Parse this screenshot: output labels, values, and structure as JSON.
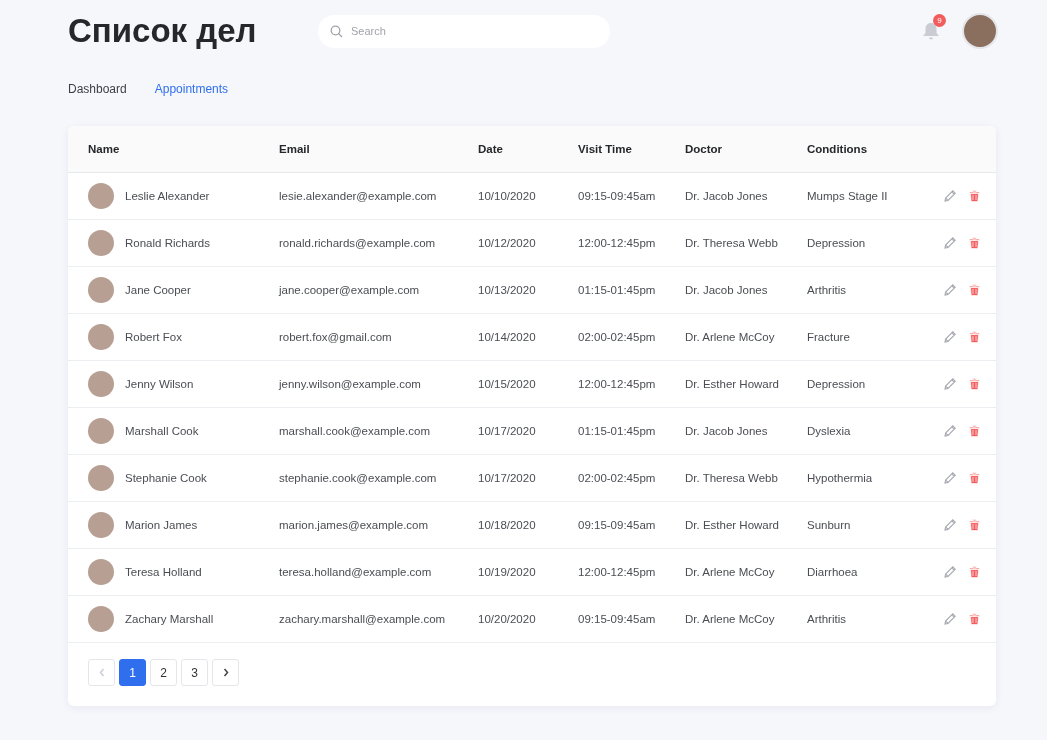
{
  "header": {
    "title": "Список дел",
    "search": {
      "placeholder": "Search"
    },
    "notifications": {
      "count": "9"
    }
  },
  "tabs": [
    {
      "label": "Dashboard",
      "selected": false
    },
    {
      "label": "Appointments",
      "selected": true
    }
  ],
  "table": {
    "columns": [
      "Name",
      "Email",
      "Date",
      "Visit Time",
      "Doctor",
      "Conditions"
    ],
    "rows": [
      {
        "name": "Leslie Alexander",
        "email": "lesie.alexander@example.com",
        "date": "10/10/2020",
        "time": "09:15-09:45am",
        "doctor": "Dr. Jacob Jones",
        "condition": "Mumps Stage II"
      },
      {
        "name": "Ronald Richards",
        "email": "ronald.richards@example.com",
        "date": "10/12/2020",
        "time": "12:00-12:45pm",
        "doctor": "Dr. Theresa Webb",
        "condition": "Depression"
      },
      {
        "name": "Jane Cooper",
        "email": "jane.cooper@example.com",
        "date": "10/13/2020",
        "time": "01:15-01:45pm",
        "doctor": "Dr. Jacob Jones",
        "condition": "Arthritis"
      },
      {
        "name": "Robert Fox",
        "email": "robert.fox@gmail.com",
        "date": "10/14/2020",
        "time": "02:00-02:45pm",
        "doctor": "Dr. Arlene McCoy",
        "condition": "Fracture"
      },
      {
        "name": "Jenny Wilson",
        "email": "jenny.wilson@example.com",
        "date": "10/15/2020",
        "time": "12:00-12:45pm",
        "doctor": "Dr. Esther Howard",
        "condition": "Depression"
      },
      {
        "name": "Marshall Cook",
        "email": "marshall.cook@example.com",
        "date": "10/17/2020",
        "time": "01:15-01:45pm",
        "doctor": "Dr. Jacob Jones",
        "condition": "Dyslexia"
      },
      {
        "name": "Stephanie Cook",
        "email": "stephanie.cook@example.com",
        "date": "10/17/2020",
        "time": "02:00-02:45pm",
        "doctor": "Dr. Theresa Webb",
        "condition": "Hypothermia"
      },
      {
        "name": "Marion James",
        "email": "marion.james@example.com",
        "date": "10/18/2020",
        "time": "09:15-09:45am",
        "doctor": "Dr. Esther Howard",
        "condition": "Sunburn"
      },
      {
        "name": "Teresa Holland",
        "email": "teresa.holland@example.com",
        "date": "10/19/2020",
        "time": "12:00-12:45pm",
        "doctor": "Dr. Arlene McCoy",
        "condition": "Diarrhoea"
      },
      {
        "name": "Zachary Marshall",
        "email": "zachary.marshall@example.com",
        "date": "10/20/2020",
        "time": "09:15-09:45am",
        "doctor": "Dr. Arlene McCoy",
        "condition": "Arthritis"
      }
    ]
  },
  "pagination": {
    "previous": {
      "disabled": true
    },
    "pages": [
      {
        "label": "1",
        "selected": true
      },
      {
        "label": "2",
        "selected": false
      },
      {
        "label": "3",
        "selected": false
      }
    ],
    "next": {
      "disabled": false
    }
  }
}
